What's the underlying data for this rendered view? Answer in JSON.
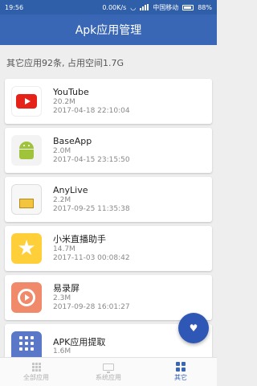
{
  "status": {
    "time": "19:56",
    "net_speed": "0.00K/s",
    "carrier": "中国移动",
    "battery": "88%"
  },
  "appbar": {
    "title": "Apk应用管理"
  },
  "summary": "其它应用92条, 占用空间1.7G",
  "apps": [
    {
      "name": "YouTube",
      "size": "20.2M",
      "date": "2017-04-18 22:10:04",
      "icon": "youtube-icon"
    },
    {
      "name": "BaseApp",
      "size": "2.0M",
      "date": "2017-04-15 23:15:50",
      "icon": "android-icon"
    },
    {
      "name": "AnyLive",
      "size": "2.2M",
      "date": "2017-09-25 11:35:38",
      "icon": "anylive-icon"
    },
    {
      "name": "小米直播助手",
      "size": "14.7M",
      "date": "2017-11-03 00:08:42",
      "icon": "mi-live-icon"
    },
    {
      "name": "易录屏",
      "size": "2.3M",
      "date": "2017-09-28 16:01:27",
      "icon": "screen-record-icon"
    },
    {
      "name": "APK应用提取",
      "size": "1.6M",
      "date": "",
      "icon": "apk-extract-icon"
    }
  ],
  "nav": {
    "all": "全部应用",
    "system": "系统应用",
    "other": "其它"
  },
  "colors": {
    "primary": "#3a67b5",
    "statusbar": "#2f5fa8",
    "fab": "#2f57b5"
  }
}
